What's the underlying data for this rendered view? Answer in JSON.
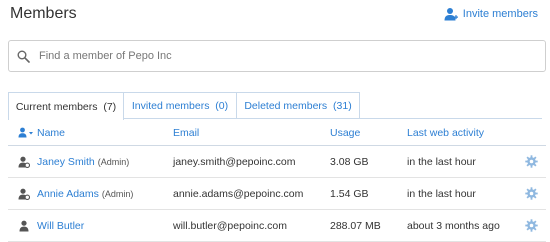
{
  "header": {
    "title": "Members",
    "invite_label": "Invite members"
  },
  "search": {
    "placeholder": "Find a member of Pepo Inc",
    "value": ""
  },
  "tabs": [
    {
      "label": "Current members  (7)",
      "active": true
    },
    {
      "label": "Invited members  (0)",
      "active": false
    },
    {
      "label": "Deleted members  (31)",
      "active": false
    }
  ],
  "table": {
    "columns": {
      "name": "Name",
      "email": "Email",
      "usage": "Usage",
      "activity": "Last web activity"
    },
    "rows": [
      {
        "name": "Janey Smith",
        "role": "(Admin)",
        "email": "janey.smith@pepoinc.com",
        "usage": "3.08 GB",
        "activity": "in the last hour"
      },
      {
        "name": "Annie Adams",
        "role": "(Admin)",
        "email": "annie.adams@pepoinc.com",
        "usage": "1.54 GB",
        "activity": "in the last hour"
      },
      {
        "name": "Will Butler",
        "role": "",
        "email": "will.butler@pepoinc.com",
        "usage": "288.07 MB",
        "activity": "about 3 months ago"
      }
    ]
  },
  "colors": {
    "accent": "#2d7fd3",
    "tab_border": "#c9d9ea",
    "gear": "#8fb8e0"
  },
  "icons": {
    "invite": "add-user-icon",
    "search": "search-icon",
    "sort": "user-sort-icon",
    "admin": "user-admin-icon",
    "member": "user-icon",
    "settings": "gear-icon"
  }
}
